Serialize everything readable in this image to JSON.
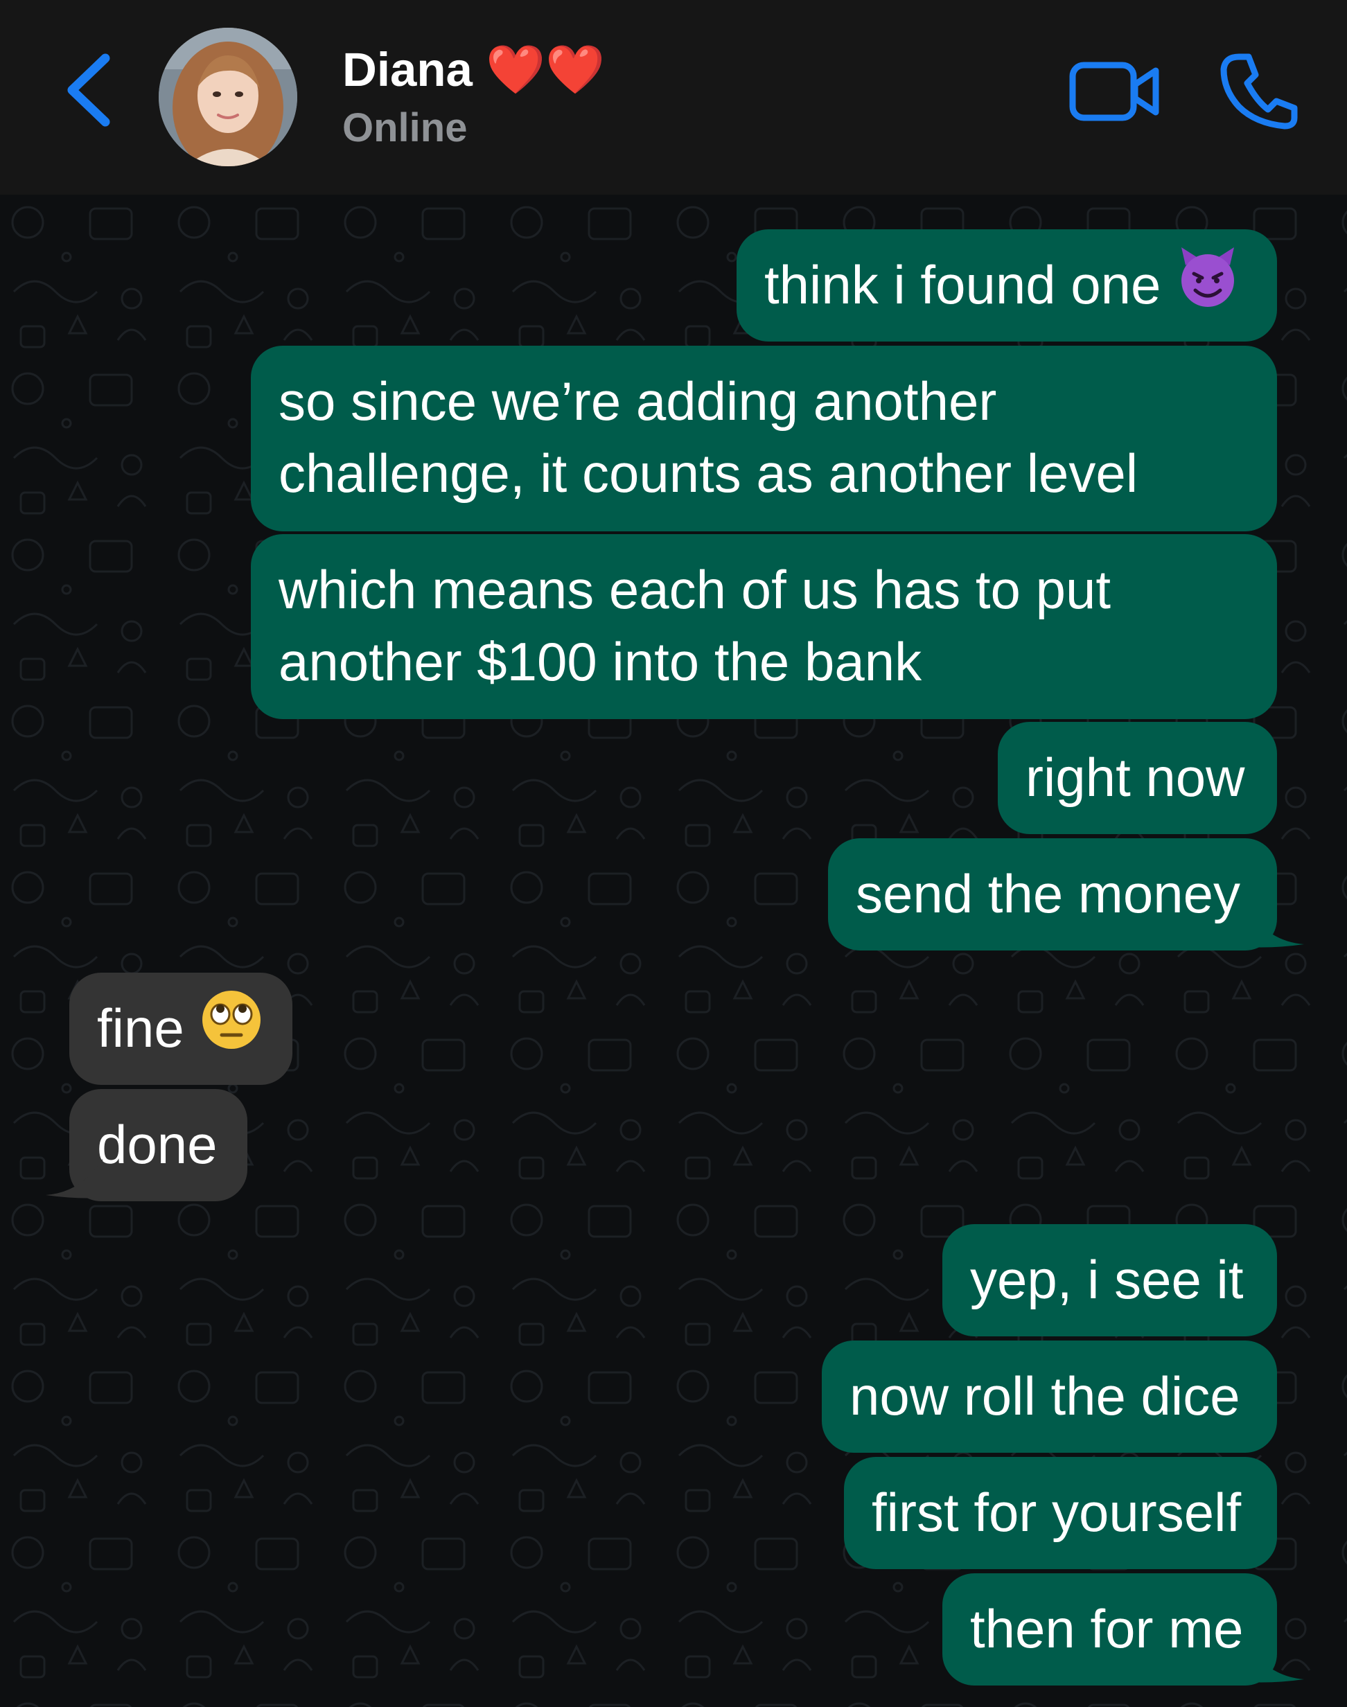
{
  "header": {
    "contact_name": "Diana ❤️❤️",
    "status": "Online"
  },
  "icons": {
    "back": "chevron-left-icon",
    "video": "video-camera-icon",
    "call": "phone-icon",
    "avatar": "contact-photo"
  },
  "colors": {
    "accent": "#1a7cf2",
    "outgoing_bubble": "#005c4b",
    "incoming_bubble": "#343434",
    "header_bg": "#161616"
  },
  "messages": [
    {
      "direction": "out",
      "text": "think i found one",
      "emoji": "smiling-face-with-horns"
    },
    {
      "direction": "out",
      "lines": [
        "so since we’re adding another",
        "challenge, it counts as another level"
      ]
    },
    {
      "direction": "out",
      "lines": [
        "which means each of us has to put",
        "another $100 into the bank"
      ]
    },
    {
      "direction": "out",
      "text": "right now"
    },
    {
      "direction": "out",
      "text": "send the money"
    },
    {
      "direction": "in",
      "text": "fine",
      "emoji": "face-with-rolling-eyes"
    },
    {
      "direction": "in",
      "text": "done"
    },
    {
      "direction": "out",
      "text": "yep, i see it"
    },
    {
      "direction": "out",
      "text": "now roll the dice"
    },
    {
      "direction": "out",
      "text": "first for yourself"
    },
    {
      "direction": "out",
      "text": "then for me"
    }
  ]
}
